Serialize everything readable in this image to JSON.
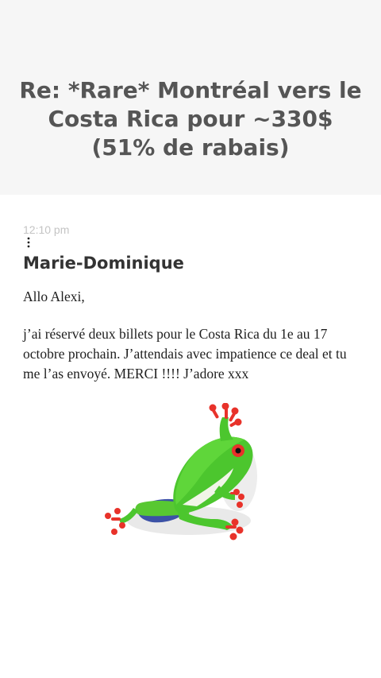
{
  "email": {
    "subject": "Re: *Rare* Montréal vers le Costa Rica pour ~330$ (51% de rabais)",
    "timestamp": "12:10 pm",
    "more_icon": "vertical-ellipsis-icon",
    "sender": "Marie-Dominique",
    "greeting": "Allo Alexi,",
    "body": "j’ai réservé deux billets pour le Costa Rica du 1e au 17 octobre prochain. J’attendais avec impatience ce deal et tu me l’as envoyé. MERCI !!!! J’adore xxx",
    "image_icon": "red-eyed-tree-frog-image"
  },
  "colors": {
    "header_background": "#f6f6f6",
    "subject_text": "#555555",
    "timestamp_text": "#c4c4c4",
    "sender_text": "#333333",
    "body_text": "#1e1e1e",
    "frog_green": "#4cc62e",
    "frog_red": "#e8322a"
  }
}
